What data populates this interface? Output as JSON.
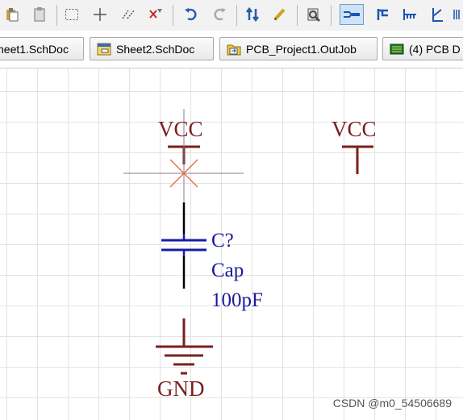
{
  "toolbar": {
    "buttons": [
      {
        "id": "paste-icon"
      },
      {
        "id": "rubber-stamp-icon"
      },
      {
        "id": "select-area-icon"
      },
      {
        "id": "move-icon"
      },
      {
        "id": "select-overlap-icon"
      },
      {
        "id": "deselect-icon"
      },
      {
        "id": "undo-icon"
      },
      {
        "id": "redo-icon"
      },
      {
        "id": "cross-probe-icon"
      },
      {
        "id": "design-rule-icon"
      },
      {
        "id": "browse-component-icon"
      },
      {
        "id": "place-wire-icon",
        "active": true
      },
      {
        "id": "place-bus-icon"
      },
      {
        "id": "place-bus-entry-icon"
      },
      {
        "id": "place-net-label-icon"
      }
    ]
  },
  "tabs": [
    {
      "label": "heet1.SchDoc"
    },
    {
      "label": "Sheet2.SchDoc"
    },
    {
      "label": "PCB_Project1.OutJob"
    },
    {
      "label": "(4) PCB D"
    }
  ],
  "schematic": {
    "vcc_left": "VCC",
    "vcc_right": "VCC",
    "cap_designator": "C?",
    "cap_comment": "Cap",
    "cap_value": "100pF",
    "gnd": "GND"
  },
  "watermark": "CSDN @m0_54506689",
  "colors": {
    "power": "#7a1f1f",
    "wire": "#000000",
    "cap": "#1a1aa8",
    "cursor": "#e86a3a",
    "grid": "#e3e3e3"
  }
}
